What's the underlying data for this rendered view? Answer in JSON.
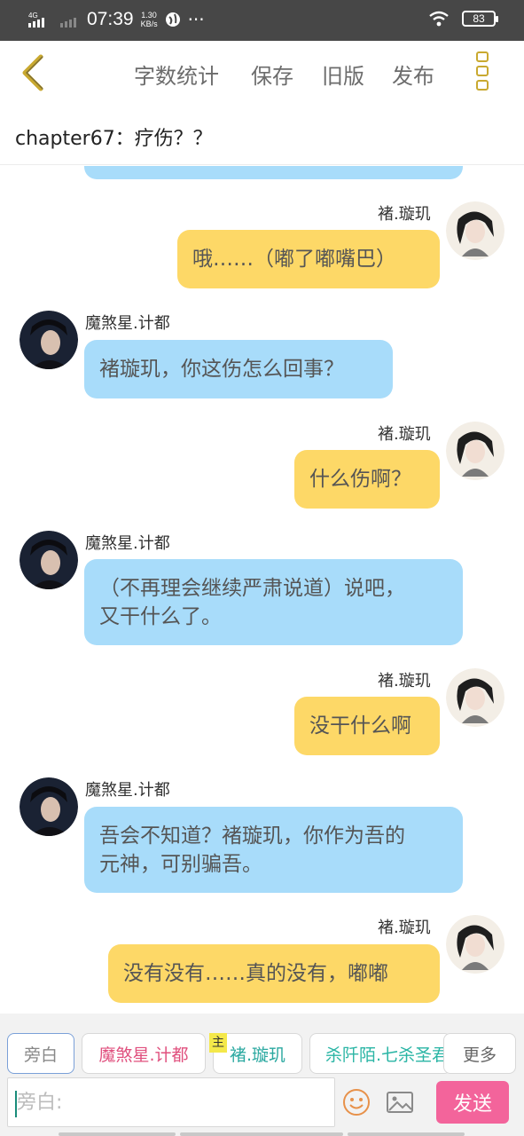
{
  "status_bar": {
    "network": "4G",
    "time": "07:39",
    "speed_value": "1.30",
    "speed_unit": "KB/s",
    "dots": "···",
    "battery": "83"
  },
  "toolbar": {
    "word_count": "字数统计",
    "save": "保存",
    "old_version": "旧版",
    "publish": "发布"
  },
  "chapter_title": "chapter67：疗伤？？",
  "messages": [
    {
      "side": "right",
      "name": "褚.璇玑",
      "text": "哦……（嘟了嘟嘴巴）"
    },
    {
      "side": "left",
      "name": "魔煞星.计都",
      "text": "褚璇玑，你这伤怎么回事？"
    },
    {
      "side": "right",
      "name": "褚.璇玑",
      "text": "什么伤啊？"
    },
    {
      "side": "left",
      "name": "魔煞星.计都",
      "text_line1": "（不再理会继续严肃说道）说吧，",
      "text_line2": "又干什么了。"
    },
    {
      "side": "right",
      "name": "褚.璇玑",
      "text": "没干什么啊"
    },
    {
      "side": "left",
      "name": "魔煞星.计都",
      "text_line1": "吾会不知道？褚璇玑，你作为吾的",
      "text_line2": "元神，可别骗吾。"
    },
    {
      "side": "right",
      "name": "褚.璇玑",
      "text": "没有没有……真的没有，嘟嘟"
    }
  ],
  "roles": {
    "narration": "旁白",
    "role1": "魔煞星.计都",
    "role2": "褚.璇玑",
    "role2_tag": "主",
    "role3": "杀阡陌.七杀圣君",
    "more": "更多"
  },
  "input": {
    "placeholder": "旁白:"
  },
  "send_label": "发送",
  "colors": {
    "blue_bubble": "#a8dcfa",
    "yellow_bubble": "#fdd867",
    "send": "#f3649b",
    "role1": "#e0507e",
    "role2": "#2aa8a0",
    "role3": "#2ab5a5",
    "accent": "#c9a930"
  }
}
